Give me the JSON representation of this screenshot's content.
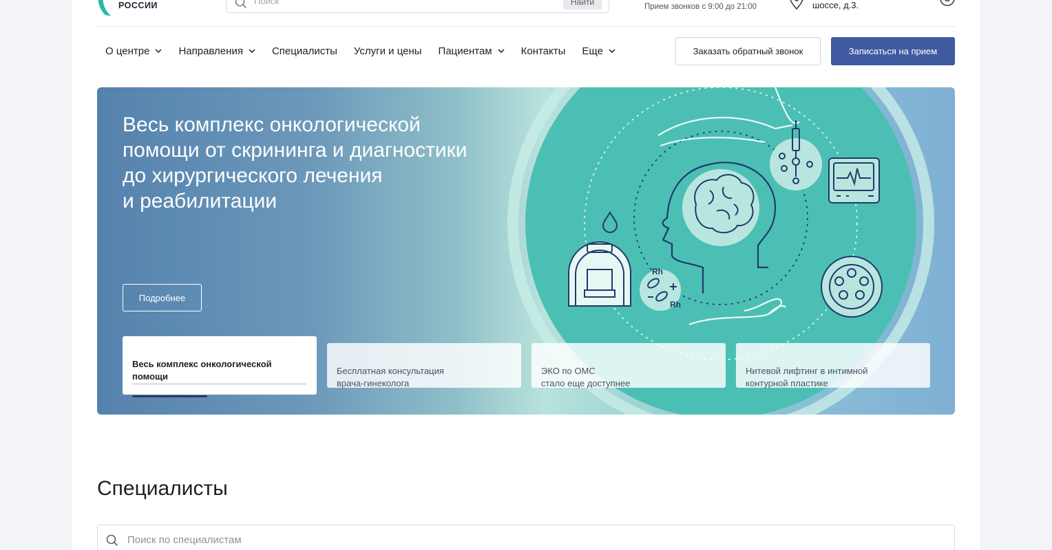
{
  "header": {
    "logo_text": "РОССИИ",
    "search_placeholder": "Поиск",
    "search_button": "Найти",
    "call_hours": "Прием звонков с 9:00 до 21:00",
    "address": "шоссе, д.3."
  },
  "nav": {
    "items": [
      {
        "label": "О центре",
        "dropdown": true
      },
      {
        "label": "Направления",
        "dropdown": true
      },
      {
        "label": "Специалисты",
        "dropdown": false
      },
      {
        "label": "Услуги и цены",
        "dropdown": false
      },
      {
        "label": "Пациентам",
        "dropdown": true
      },
      {
        "label": "Контакты",
        "dropdown": false
      },
      {
        "label": "Еще",
        "dropdown": true
      }
    ],
    "callback_button": "Заказать обратный звонок",
    "appointment_button": "Записаться на прием"
  },
  "hero": {
    "title": "Весь комплекс онкологической\nпомощи от скрининга и диагностики\nдо хирургического лечения\nи реабилитации",
    "more_button": "Подробнее",
    "illustration_labels": [
      "Rh",
      "Rh"
    ],
    "slides": [
      {
        "text": "Весь комплекс онкологической\nпомощи",
        "active": true,
        "progress": 0.43
      },
      {
        "text": "Бесплатная консультация\nврача-гинеколога",
        "active": false
      },
      {
        "text": "ЭКО по ОМС\nстало еще доступнее",
        "active": false
      },
      {
        "text": "Нитевой лифтинг в интимной\nконтурной пластике",
        "active": false
      }
    ]
  },
  "specialists": {
    "title": "Специалисты",
    "search_placeholder": "Поиск по специалистам"
  },
  "colors": {
    "primary_button": "#3f5aa0",
    "hero_circle": "#4cbfb4",
    "illustration_stroke": "#1f3a6b",
    "progress_fill": "#2a3a6b",
    "logo_accent": "#2bb7a8"
  }
}
